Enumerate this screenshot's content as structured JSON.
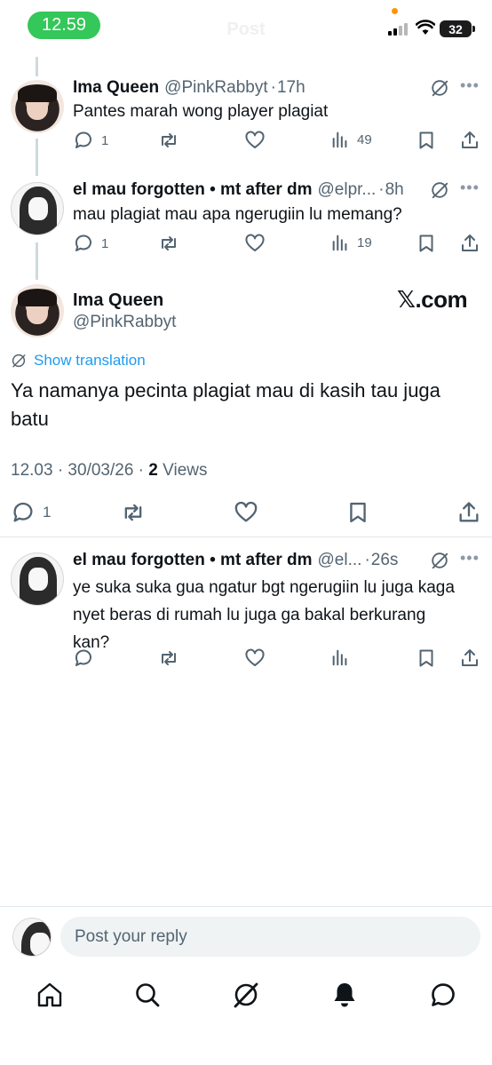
{
  "status": {
    "time": "12.59",
    "battery": "32",
    "ghost_title": "Post"
  },
  "thread": [
    {
      "name": "Ima Queen",
      "handle": "@PinkRabbyt",
      "dot": "·",
      "time": "17h",
      "text": "Pantes marah wong player plagiat",
      "replies": "1",
      "views": "49"
    },
    {
      "name": "el mau forgotten • mt after dm",
      "handle": "@elpr...",
      "dot": "·",
      "time": "8h",
      "text": "mau plagiat mau apa ngerugiin lu memang?",
      "replies": "1",
      "views": "19"
    }
  ],
  "main": {
    "name": "Ima Queen",
    "handle": "@PinkRabbyt",
    "watermark": "𝕏.com",
    "show_translation": "Show translation",
    "text": "Ya namanya pecinta plagiat  mau di kasih tau juga batu",
    "time": "12.03 · 30/03/26 · ",
    "views_count": "2",
    "views_label": " Views",
    "replies": "1"
  },
  "reply": {
    "name": "el mau forgotten • mt after dm",
    "handle": "@el...",
    "dot": "·",
    "time": "26s",
    "text": "ye suka suka gua ngatur bgt ngerugiin lu juga kaga nyet beras di rumah lu juga ga bakal berkurang kan?"
  },
  "composer": {
    "placeholder": "Post your reply"
  },
  "nav": [
    "home-icon",
    "search-icon",
    "grok-icon",
    "notifications-icon",
    "messages-icon"
  ],
  "colors": {
    "accent": "#1d9bf0",
    "muted": "#536471",
    "text": "#0f1419",
    "pill": "#34c759"
  }
}
